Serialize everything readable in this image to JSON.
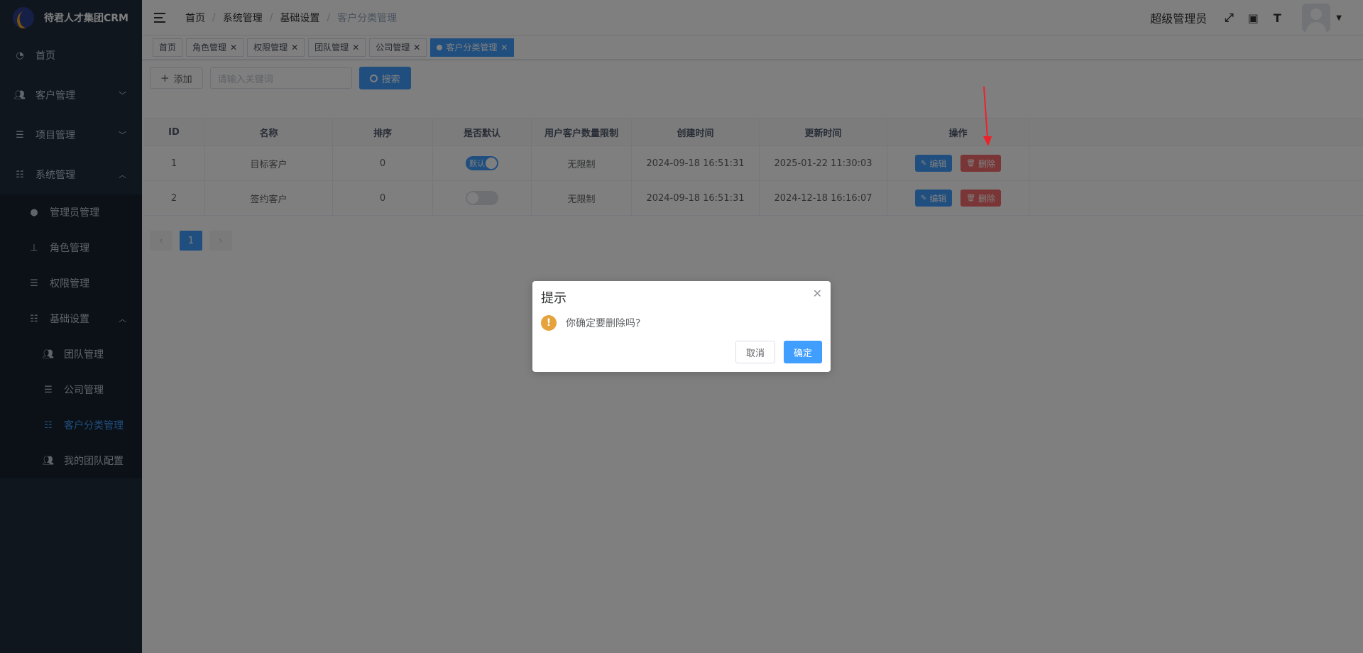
{
  "app": {
    "title": "待君人才集团CRM"
  },
  "sidebar": {
    "items": [
      {
        "label": "首页",
        "icon": "dashboard-icon"
      },
      {
        "label": "客户管理",
        "icon": "users-icon"
      },
      {
        "label": "项目管理",
        "icon": "list-icon"
      },
      {
        "label": "系统管理",
        "icon": "sliders-icon"
      }
    ],
    "system": [
      {
        "label": "管理员管理",
        "icon": "user-icon"
      },
      {
        "label": "角色管理",
        "icon": "org-icon"
      },
      {
        "label": "权限管理",
        "icon": "tree-icon"
      },
      {
        "label": "基础设置",
        "icon": "sliders-icon"
      }
    ],
    "basic": [
      {
        "label": "团队管理",
        "icon": "users-icon"
      },
      {
        "label": "公司管理",
        "icon": "list-icon"
      },
      {
        "label": "客户分类管理",
        "icon": "sliders-icon"
      },
      {
        "label": "我的团队配置",
        "icon": "users-icon"
      }
    ]
  },
  "header": {
    "breadcrumb": [
      "首页",
      "系统管理",
      "基础设置",
      "客户分类管理"
    ],
    "admin_name": "超级管理员"
  },
  "tags": [
    "首页",
    "角色管理",
    "权限管理",
    "团队管理",
    "公司管理",
    "客户分类管理"
  ],
  "toolbar": {
    "add_label": "添加",
    "search_placeholder": "请输入关键词",
    "search_label": "搜索"
  },
  "table": {
    "headers": [
      "ID",
      "名称",
      "排序",
      "是否默认",
      "用户客户数量限制",
      "创建时间",
      "更新时间",
      "操作"
    ],
    "rows": [
      {
        "id": "1",
        "name": "目标客户",
        "sort": "0",
        "default": true,
        "default_label": "默认",
        "limit": "无限制",
        "created": "2024-09-18 16:51:31",
        "updated": "2025-01-22 11:30:03"
      },
      {
        "id": "2",
        "name": "签约客户",
        "sort": "0",
        "default": false,
        "default_label": "",
        "limit": "无限制",
        "created": "2024-09-18 16:51:31",
        "updated": "2024-12-18 16:16:07"
      }
    ],
    "edit_label": "编辑",
    "delete_label": "删除"
  },
  "pager": {
    "current": "1"
  },
  "dialog": {
    "title": "提示",
    "message": "你确定要删除吗?",
    "cancel_label": "取消",
    "confirm_label": "确定"
  },
  "colors": {
    "primary": "#409eff",
    "danger": "#f56c6c",
    "warning": "#e6a23c",
    "sidebar": "#1f2d3d"
  }
}
